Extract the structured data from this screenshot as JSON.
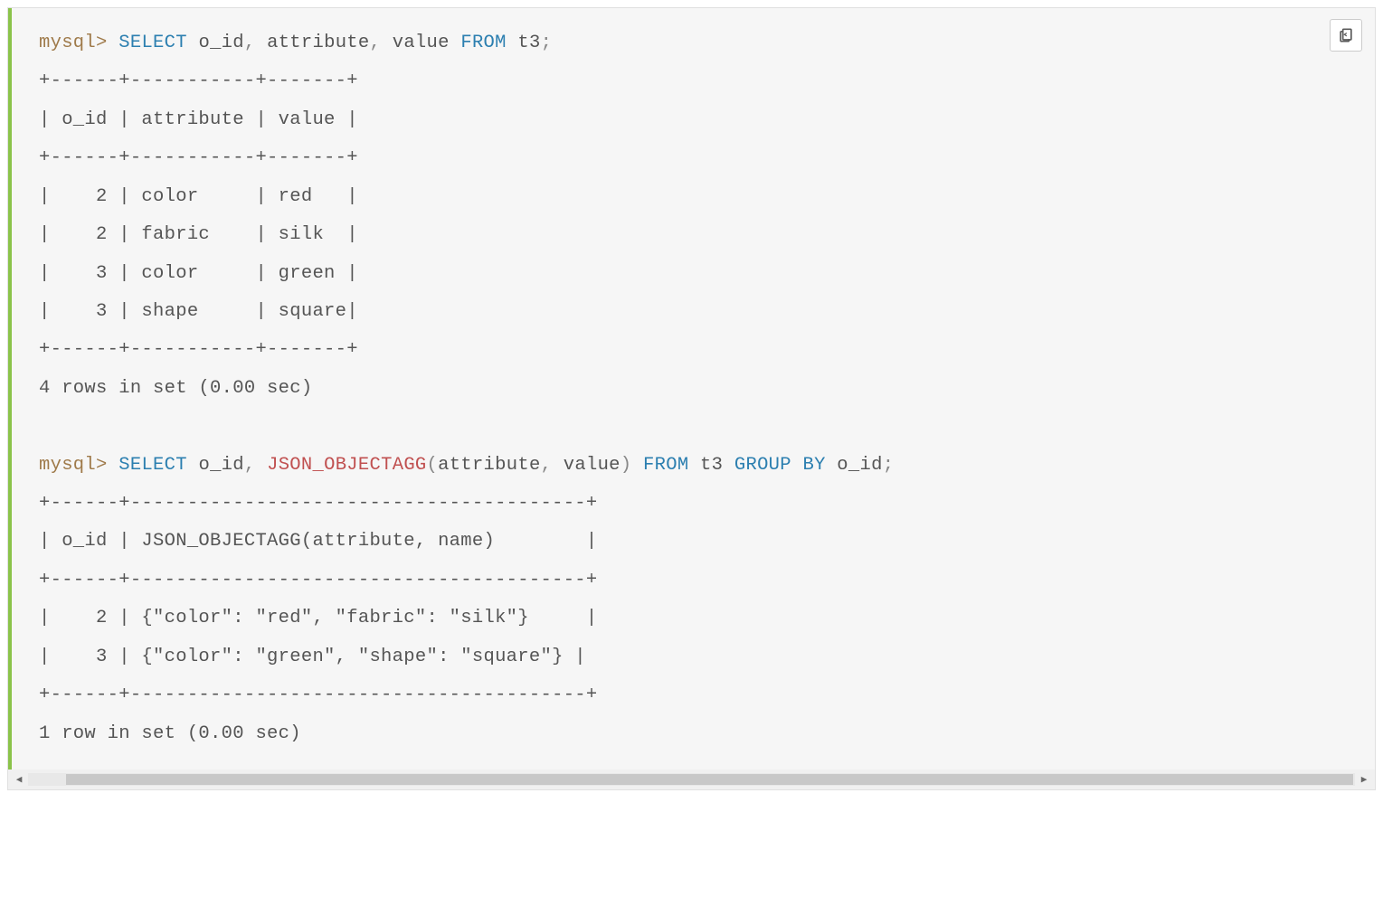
{
  "code": {
    "line1_prompt": "mysql>",
    "line1_kw1": "SELECT",
    "line1_id1": " o_id",
    "line1_c1": ",",
    "line1_id2": " attribute",
    "line1_c2": ",",
    "line1_id3": " value ",
    "line1_kw2": "FROM",
    "line1_id4": " t3",
    "line1_semi": ";",
    "table1_sep1": "+------+-----------+-------+",
    "table1_head": "| o_id | attribute | value |",
    "table1_sep2": "+------+-----------+-------+",
    "table1_r1": "|    2 | color     | red   |",
    "table1_r2": "|    2 | fabric    | silk  |",
    "table1_r3": "|    3 | color     | green |",
    "table1_r4": "|    3 | shape     | square|",
    "table1_sep3": "+------+-----------+-------+",
    "table1_foot": "4 rows in set (0.00 sec)",
    "blank": "",
    "line2_prompt": "mysql>",
    "line2_kw1": "SELECT",
    "line2_id1": " o_id",
    "line2_c1": ",",
    "line2_sp1": " ",
    "line2_fn": "JSON_OBJECTAGG",
    "line2_p1": "(",
    "line2_arg1": "attribute",
    "line2_c2": ",",
    "line2_arg2": " value",
    "line2_p2": ")",
    "line2_sp2": " ",
    "line2_kw2": "FROM",
    "line2_id2": " t3 ",
    "line2_kw3": "GROUP",
    "line2_sp3": " ",
    "line2_kw4": "BY",
    "line2_id3": " o_id",
    "line2_semi": ";",
    "table2_sep1": "+------+----------------------------------------+",
    "table2_head": "| o_id | JSON_OBJECTAGG(attribute, name)        |",
    "table2_sep2": "+------+----------------------------------------+",
    "table2_r1": "|    2 | {\"color\": \"red\", \"fabric\": \"silk\"}     |",
    "table2_r2": "|    3 | {\"color\": \"green\", \"shape\": \"square\"} |",
    "table2_sep3": "+------+----------------------------------------+",
    "table2_foot": "1 row in set (0.00 sec)"
  },
  "scroll": {
    "left": "◀",
    "right": "▶"
  }
}
